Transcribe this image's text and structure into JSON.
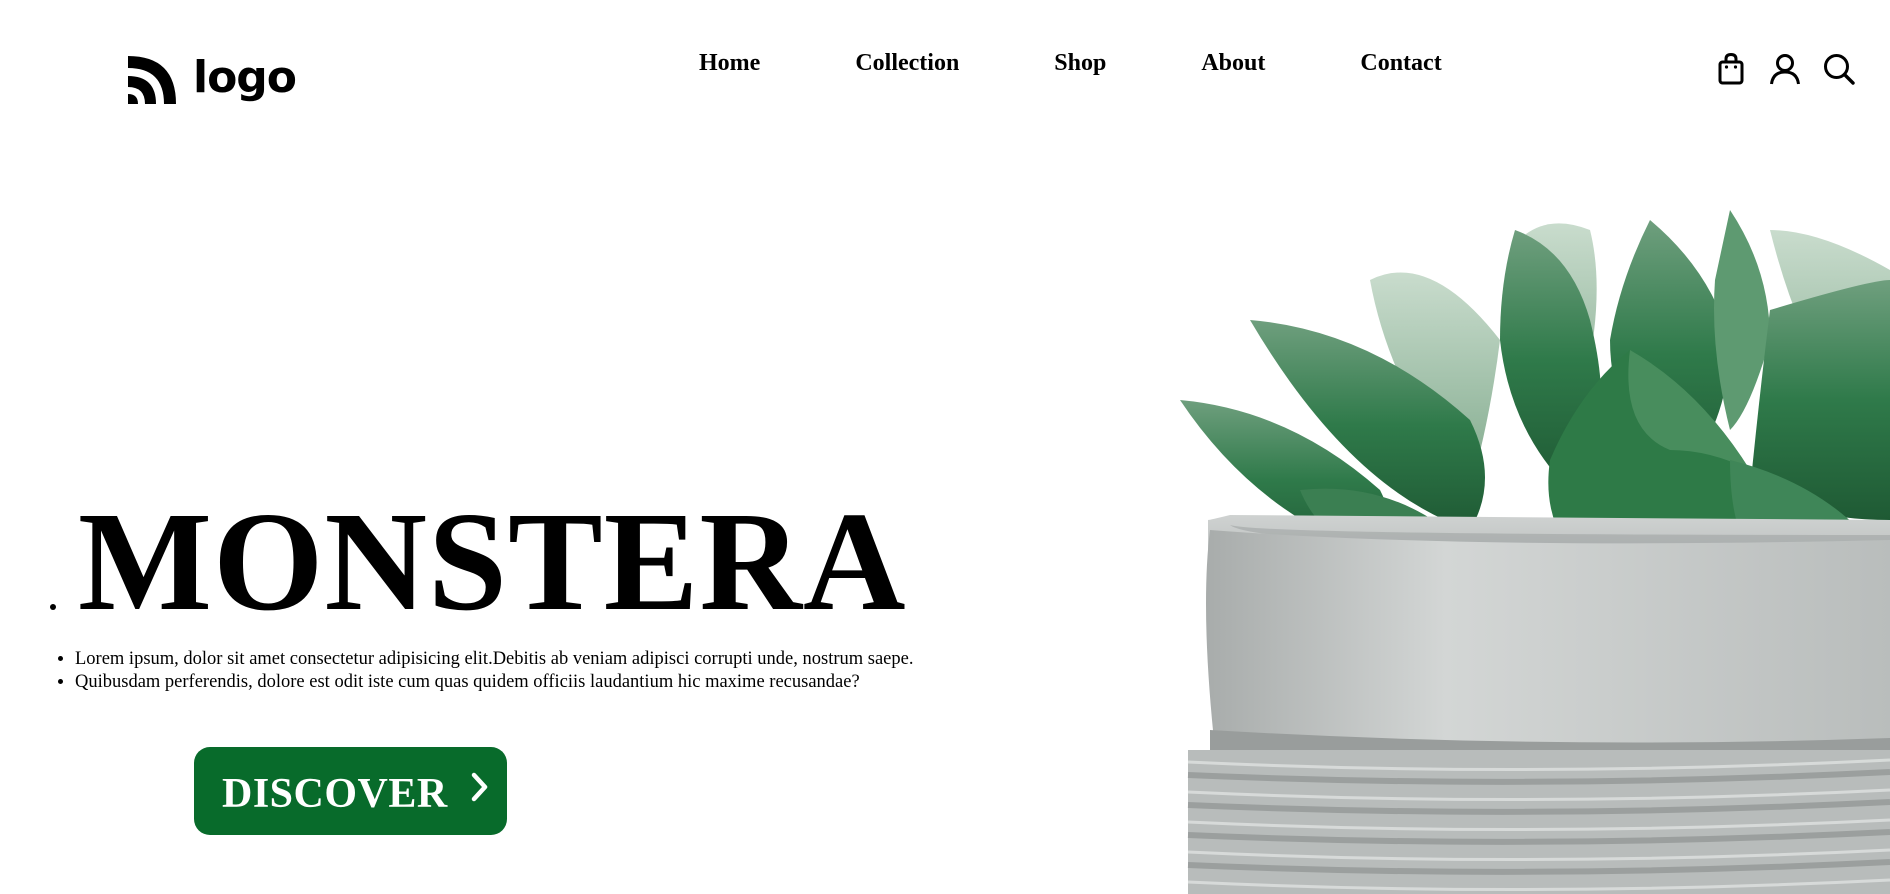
{
  "header": {
    "logo_text": "logo",
    "nav": [
      {
        "label": "Home"
      },
      {
        "label": "Collection"
      },
      {
        "label": "Shop"
      },
      {
        "label": "About"
      },
      {
        "label": "Contact"
      }
    ],
    "icons": [
      "shopping-bag-icon",
      "user-icon",
      "search-icon"
    ]
  },
  "hero": {
    "title": "MONSTERA",
    "bullets": [
      "Lorem ipsum, dolor sit amet consectetur adipisicing elit.Debitis ab veniam adipisci corrupti unde, nostrum saepe.",
      "Quibusdam perferendis, dolore est odit iste cum quas quidem officiis laudantium hic maxime recusandae?"
    ],
    "button_label": "DISCOVER",
    "button_icon": "chevron-right-icon"
  },
  "colors": {
    "accent": "#086b2b",
    "text": "#000000",
    "background": "#ffffff"
  }
}
